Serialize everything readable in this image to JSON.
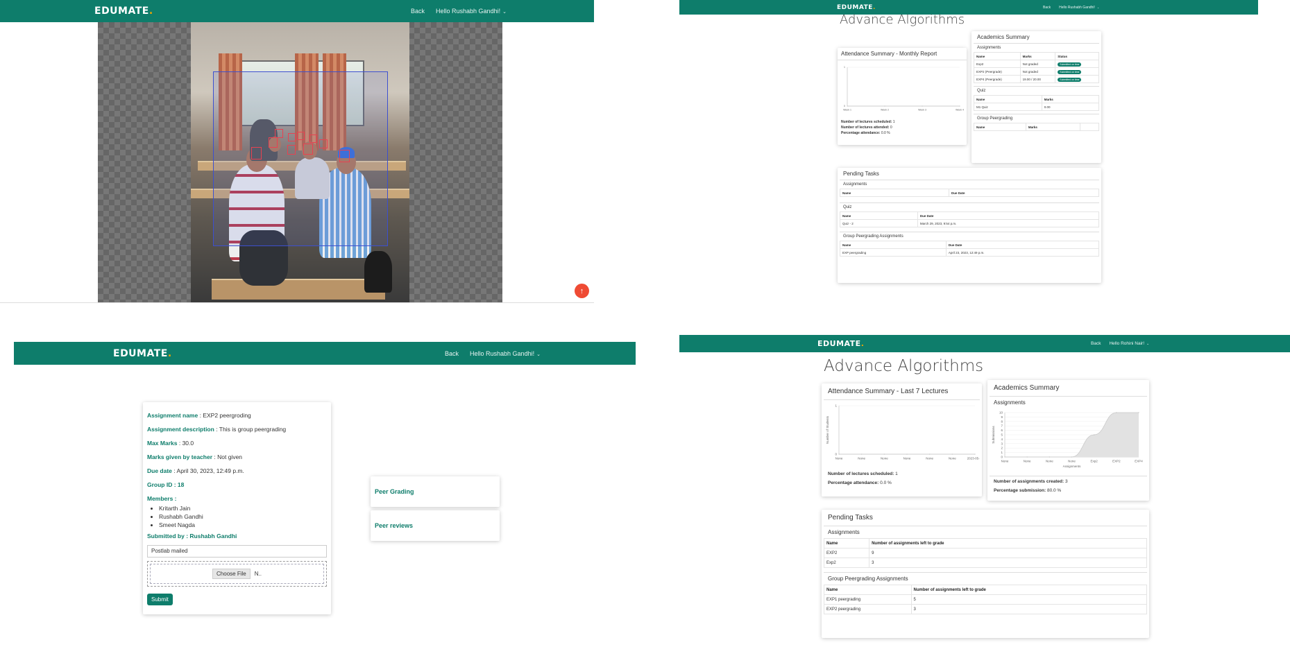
{
  "brand": {
    "name": "EDUMATE",
    "dot": "."
  },
  "panel1": {
    "nav": {
      "back": "Back",
      "user": "Hello Rushabh Gandhi!"
    },
    "fab_icon": "arrow-up-icon"
  },
  "panel2": {
    "nav": {
      "back": "Back",
      "user": "Hello Rushabh Gandhi!"
    },
    "title": "Advance Algorithms",
    "attendance": {
      "heading": "Attendance Summary - Monthly Report",
      "ylabel": "Number of lectures attended",
      "xticks": [
        "Week 1",
        "Week 2",
        "Week 3",
        "Week 4"
      ],
      "stats": [
        {
          "label": "Number of lectures scheduled:",
          "value": "1"
        },
        {
          "label": "Number of lectures attended:",
          "value": "0"
        },
        {
          "label": "Percentage attendance:",
          "value": "0.0 %"
        }
      ]
    },
    "academics": {
      "heading": "Academics Summary",
      "assignments_label": "Assignments",
      "assign_headers": [
        "Name",
        "Marks",
        "Status"
      ],
      "assign_rows": [
        {
          "name": "Exp2",
          "marks": "Not graded",
          "status": "Submitted on time"
        },
        {
          "name": "EXP2 (Peergrade)",
          "marks": "Not graded",
          "status": "Submitted on time"
        },
        {
          "name": "EXP4 (Peergrade)",
          "marks": "19.00 / 20.00",
          "status": "Submitted on time"
        }
      ],
      "quiz_label": "Quiz",
      "quiz_headers": [
        "Name",
        "Marks"
      ],
      "quiz_rows": [
        {
          "name": "M1 Quiz",
          "marks": "0.00"
        }
      ],
      "group_label": "Group Peergrading",
      "group_headers": [
        "Name",
        "Marks"
      ]
    },
    "pending": {
      "heading": "Pending Tasks",
      "assignments_label": "Assignments",
      "assign_headers": [
        "Name",
        "Due Date"
      ],
      "quiz_label": "Quiz",
      "quiz_headers": [
        "Name",
        "Due Date"
      ],
      "quiz_rows": [
        {
          "name": "Quiz - 2",
          "due": "March 29, 2023, 9:54 p.m."
        }
      ],
      "group_label": "Group Peergrading Assignments",
      "group_headers": [
        "Name",
        "Due Date"
      ],
      "group_rows": [
        {
          "name": "EXP peergrading",
          "due": "April 23, 2023, 12:49 p.m."
        }
      ]
    }
  },
  "panel3": {
    "nav": {
      "back": "Back",
      "user": "Hello Rushabh Gandhi!"
    },
    "assignment": {
      "name_label": "Assignment name",
      "name_value": ": EXP2 peergroding",
      "desc_label": "Assignment description",
      "desc_value": ": This is group peergrading",
      "max_label": "Max Marks",
      "max_value": ": 30.0",
      "marks_label": "Marks given by teacher",
      "marks_value": ": Not given",
      "due_label": "Due date",
      "due_value": ": April 30, 2023, 12:49 p.m.",
      "group_label": "Group ID : 18",
      "members_label": "Members :",
      "members": [
        "Kritarth Jain",
        "Rushabh Gandhi",
        "Smeet Nagda"
      ],
      "submitted_label": "Submitted by : Rushabh Gandhi",
      "text_value": "Postlab mailed",
      "choose_file": "Choose File",
      "file_status": "N..",
      "submit": "Submit"
    },
    "side": {
      "peer_grading": "Peer Grading",
      "peer_reviews": "Peer reviews"
    }
  },
  "panel4": {
    "nav": {
      "back": "Back",
      "user": "Hello Rohini Nair!"
    },
    "title": "Advance Algorithms",
    "attendance": {
      "heading": "Attendance Summary - Last 7 Lectures",
      "ylabel": "Number of Students",
      "xticks": [
        "None",
        "None",
        "None",
        "None",
        "None",
        "None",
        "2023-05-11"
      ],
      "stats": [
        {
          "label": "Number of lectures scheduled:",
          "value": "1"
        },
        {
          "label": "Percentage attendance:",
          "value": "0.0 %"
        }
      ]
    },
    "academics": {
      "heading": "Academics Summary",
      "assignments_label": "Assignments",
      "ylabel": "Submissions",
      "xlabel": "Assignments",
      "stats": [
        {
          "label": "Number of assignments created:",
          "value": "3"
        },
        {
          "label": "Percentage submission:",
          "value": "80.0 %"
        }
      ]
    },
    "pending": {
      "heading": "Pending Tasks",
      "assignments_label": "Assignments",
      "assign_headers": [
        "Name",
        "Number of assignments left to grade"
      ],
      "assign_rows": [
        {
          "name": "EXP2",
          "left": "9"
        },
        {
          "name": "Exp2",
          "left": "3"
        }
      ],
      "group_label": "Group Peergrading Assignments",
      "group_headers": [
        "Name",
        "Number of assignments left to grade"
      ],
      "group_rows": [
        {
          "name": "EXP1 peergrading",
          "left": "5"
        },
        {
          "name": "EXP2 peergrading",
          "left": "3"
        }
      ]
    }
  },
  "chart_data": [
    {
      "type": "line",
      "xlabel": "",
      "ylabel": "Number of lectures attended",
      "categories": [
        "Week 1",
        "Week 2",
        "Week 3",
        "Week 4"
      ],
      "series": [
        {
          "values": [
            0,
            0,
            0,
            0
          ]
        }
      ],
      "ylim": [
        0,
        1
      ]
    },
    {
      "type": "line",
      "xlabel": "",
      "ylabel": "Number of Students",
      "categories": [
        "None",
        "None",
        "None",
        "None",
        "None",
        "None",
        "2023-05-11"
      ],
      "series": [
        {
          "values": [
            0,
            0,
            0,
            0,
            0,
            0,
            0
          ]
        }
      ],
      "ylim": [
        0,
        1
      ]
    },
    {
      "type": "area",
      "xlabel": "Assignments",
      "ylabel": "Submissions",
      "categories": [
        "None",
        "None",
        "None",
        "None",
        "Exp2",
        "EXP2",
        "EXP4"
      ],
      "yticks": [
        0,
        1,
        2,
        3,
        4,
        5,
        6,
        7,
        8,
        9,
        10
      ],
      "series": [
        {
          "values": [
            0,
            0,
            0,
            0,
            5,
            10,
            10
          ]
        }
      ],
      "ylim": [
        0,
        10
      ]
    }
  ]
}
